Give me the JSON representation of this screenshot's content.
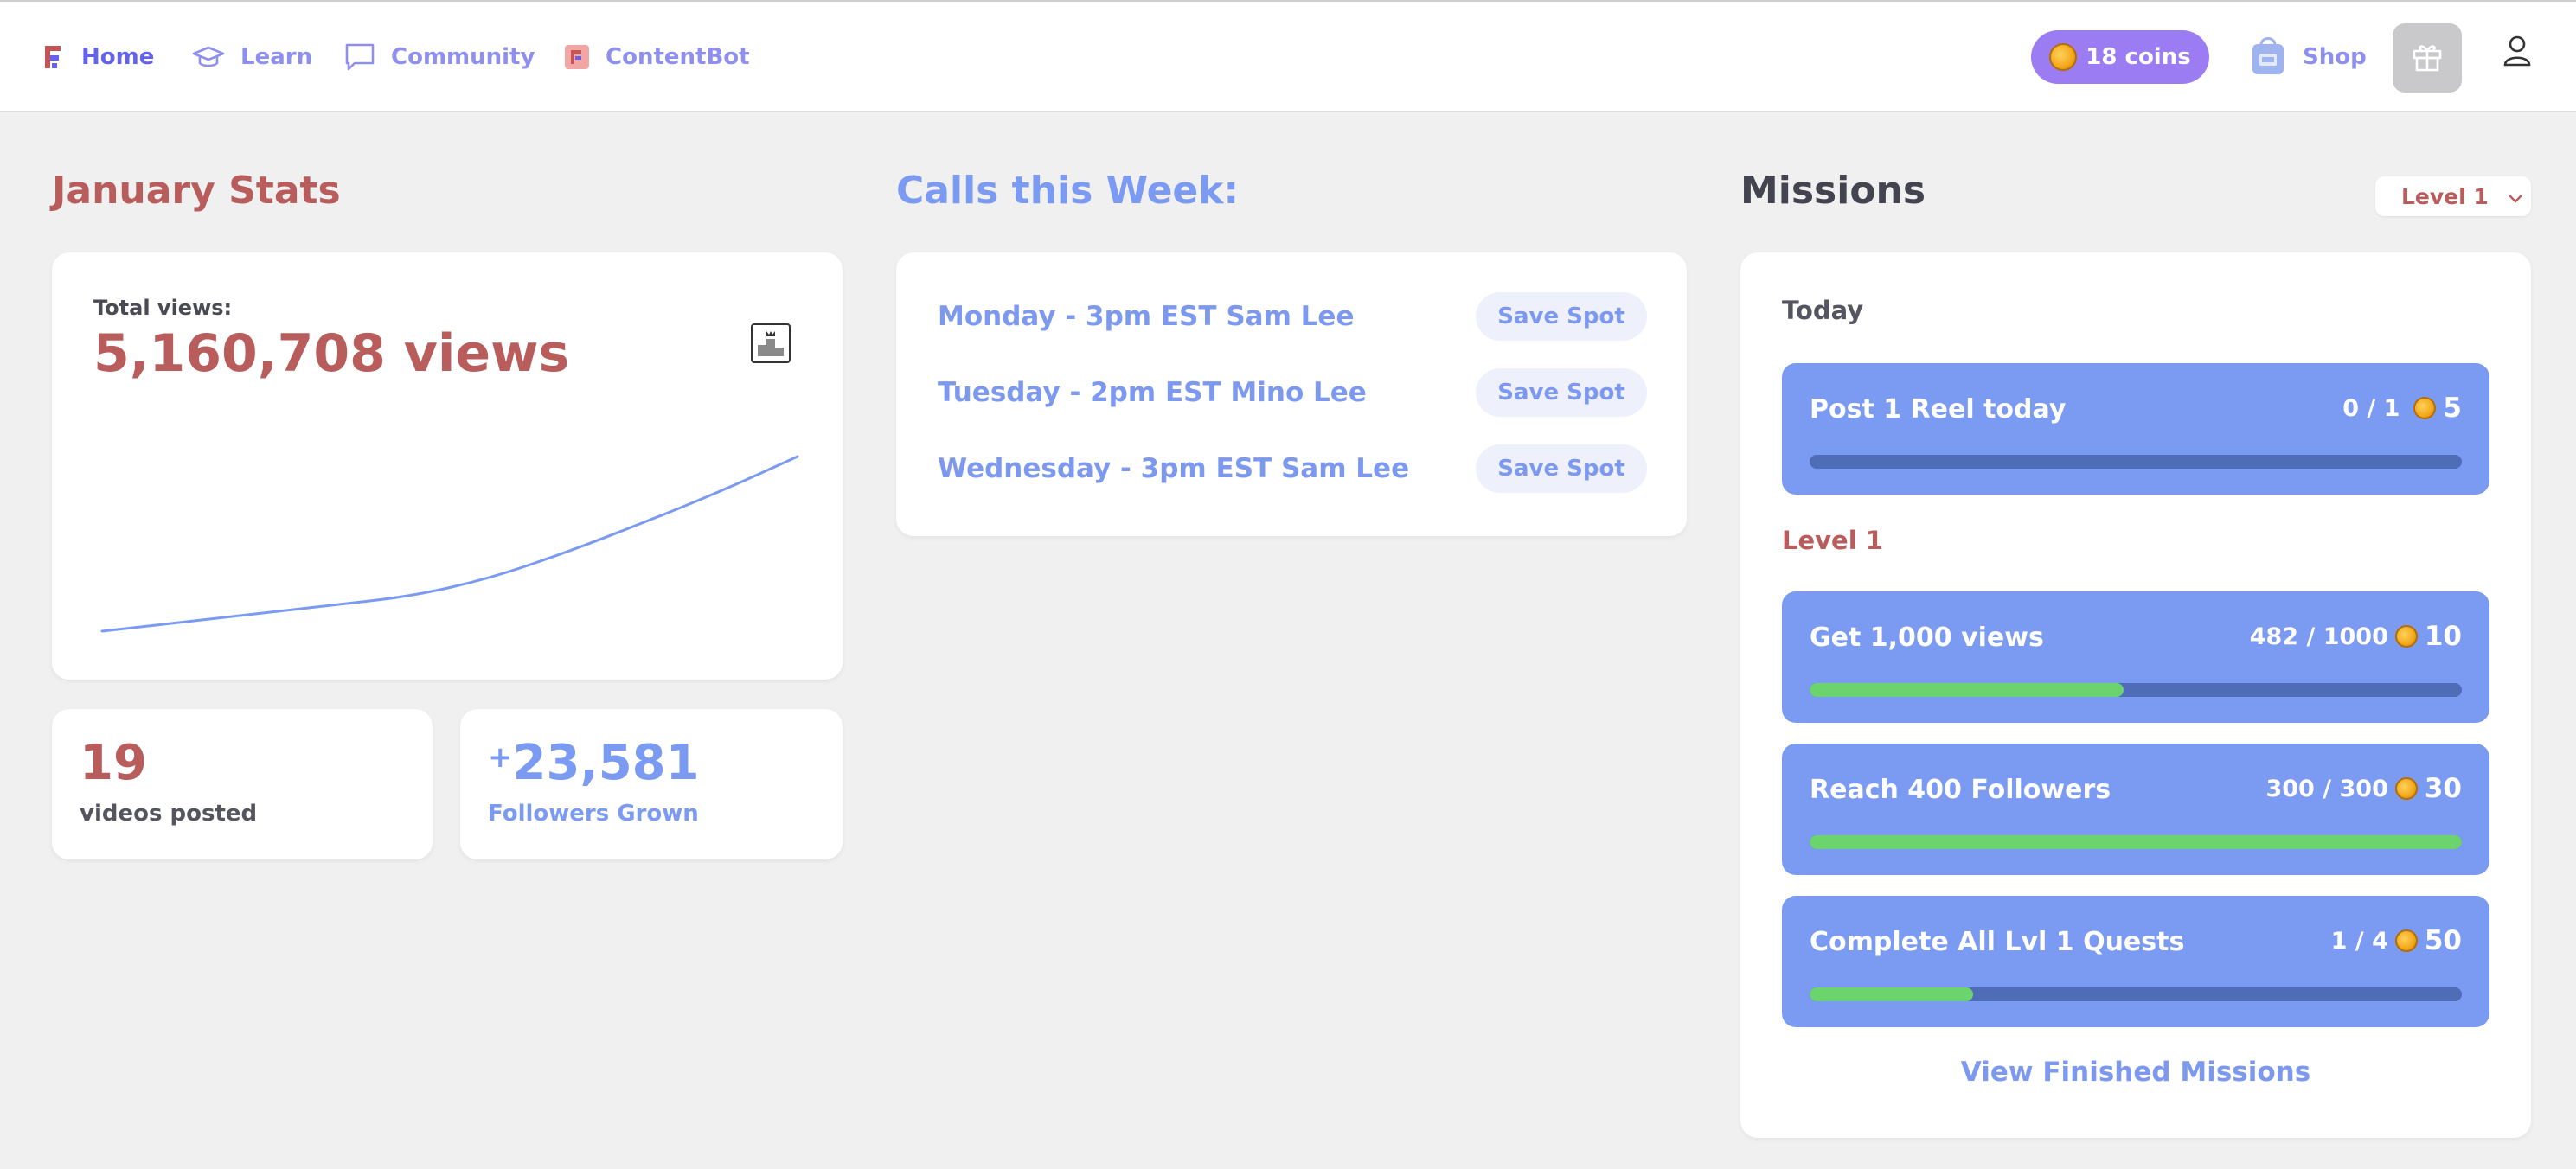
{
  "nav": {
    "items": [
      {
        "label": "Home",
        "icon": "logo-icon",
        "active": true
      },
      {
        "label": "Learn",
        "icon": "graduation-cap-icon"
      },
      {
        "label": "Community",
        "icon": "chat-bubble-icon"
      },
      {
        "label": "ContentBot",
        "icon": "contentbot-icon"
      }
    ],
    "coins_label": "18 coins",
    "shop_label": "Shop"
  },
  "stats": {
    "title": "January Stats",
    "total_views_label": "Total views:",
    "total_views_value": "5,160,708 views",
    "views_trend": [
      0.0,
      0.05,
      0.1,
      0.15,
      0.2,
      0.3,
      0.45,
      0.62,
      0.8,
      1.0
    ],
    "videos_posted_value": "19",
    "videos_posted_label": "videos posted",
    "followers_prefix": "+",
    "followers_value": "23,581",
    "followers_label": "Followers Grown"
  },
  "calls": {
    "title": "Calls this Week:",
    "items": [
      {
        "text": "Monday - 3pm EST Sam Lee",
        "button": "Save Spot"
      },
      {
        "text": "Tuesday - 2pm EST Mino Lee",
        "button": "Save Spot"
      },
      {
        "text": "Wednesday - 3pm EST Sam Lee",
        "button": "Save Spot"
      }
    ]
  },
  "missions": {
    "title": "Missions",
    "level_select": "Level 1",
    "today_label": "Today",
    "level_label": "Level 1",
    "today": [
      {
        "title": "Post 1 Reel today",
        "progress": "0 / 1",
        "reward": "5",
        "fraction": 0.0
      }
    ],
    "level": [
      {
        "title": "Get 1,000 views",
        "progress": "482 / 1000",
        "reward": "10",
        "fraction": 0.482
      },
      {
        "title": "Reach 400 Followers",
        "progress": "300 / 300",
        "reward": "30",
        "fraction": 1.0
      },
      {
        "title": "Complete All Lvl 1 Quests",
        "progress": "1 / 4",
        "reward": "50",
        "fraction": 0.25
      }
    ],
    "finished_link": "View Finished Missions"
  },
  "colors": {
    "accent": "#7b9af2",
    "brand_red": "#b85c5c",
    "nav_active": "#6363ee",
    "coins_bg": "#9b7cf3",
    "progress_green": "#6cd46c"
  }
}
